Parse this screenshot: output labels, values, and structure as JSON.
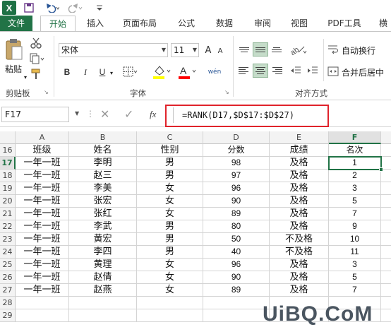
{
  "app": {
    "logo_letter": "X"
  },
  "quick_access": {
    "save_icon": "save-icon",
    "undo_icon": "undo-icon",
    "redo_icon": "redo-icon",
    "customize": "customize-arrow"
  },
  "tabs": [
    {
      "label": "文件"
    },
    {
      "label": "开始"
    },
    {
      "label": "插入"
    },
    {
      "label": "页面布局"
    },
    {
      "label": "公式"
    },
    {
      "label": "数据"
    },
    {
      "label": "审阅"
    },
    {
      "label": "视图"
    },
    {
      "label": "PDF工具"
    },
    {
      "label": "横"
    }
  ],
  "ribbon": {
    "clipboard": {
      "paste_label": "粘贴",
      "group_label": "剪贴板"
    },
    "font": {
      "font_name": "宋体",
      "font_size": "11",
      "bold": "B",
      "italic": "I",
      "underline": "U",
      "font_size_up": "A",
      "font_size_down": "A",
      "phonetic": "wén",
      "group_label": "字体"
    },
    "alignment": {
      "wrap_text": "自动换行",
      "merge_center": "合并后居中",
      "group_label": "对齐方式"
    }
  },
  "formula_bar": {
    "name_box": "F17",
    "fx": "fx",
    "formula": "=RANK(D17,$D$17:$D$27)"
  },
  "columns": [
    "A",
    "B",
    "C",
    "D",
    "E",
    "F"
  ],
  "rows": [
    {
      "n": "16",
      "a": "班级",
      "b": "姓名",
      "c": "性别",
      "d": "分数",
      "e": "成绩",
      "f": "名次"
    },
    {
      "n": "17",
      "a": "一年一班",
      "b": "李明",
      "c": "男",
      "d": "98",
      "e": "及格",
      "f": "1"
    },
    {
      "n": "18",
      "a": "一年一班",
      "b": "赵三",
      "c": "男",
      "d": "97",
      "e": "及格",
      "f": "2"
    },
    {
      "n": "19",
      "a": "一年一班",
      "b": "李美",
      "c": "女",
      "d": "96",
      "e": "及格",
      "f": "3"
    },
    {
      "n": "20",
      "a": "一年一班",
      "b": "张宏",
      "c": "女",
      "d": "90",
      "e": "及格",
      "f": "5"
    },
    {
      "n": "21",
      "a": "一年一班",
      "b": "张红",
      "c": "女",
      "d": "89",
      "e": "及格",
      "f": "7"
    },
    {
      "n": "22",
      "a": "一年一班",
      "b": "李武",
      "c": "男",
      "d": "80",
      "e": "及格",
      "f": "9"
    },
    {
      "n": "23",
      "a": "一年一班",
      "b": "黄宏",
      "c": "男",
      "d": "50",
      "e": "不及格",
      "f": "10"
    },
    {
      "n": "24",
      "a": "一年一班",
      "b": "李四",
      "c": "男",
      "d": "40",
      "e": "不及格",
      "f": "11"
    },
    {
      "n": "25",
      "a": "一年一班",
      "b": "黄理",
      "c": "女",
      "d": "96",
      "e": "及格",
      "f": "3"
    },
    {
      "n": "26",
      "a": "一年一班",
      "b": "赵倩",
      "c": "女",
      "d": "90",
      "e": "及格",
      "f": "5"
    },
    {
      "n": "27",
      "a": "一年一班",
      "b": "赵燕",
      "c": "女",
      "d": "89",
      "e": "及格",
      "f": "7"
    },
    {
      "n": "28",
      "a": "",
      "b": "",
      "c": "",
      "d": "",
      "e": "",
      "f": ""
    },
    {
      "n": "29",
      "a": "",
      "b": "",
      "c": "",
      "d": "",
      "e": "",
      "f": ""
    }
  ],
  "watermark": "UiBQ.CoM",
  "colors": {
    "excel_green": "#217346",
    "highlight_red": "#e0232b",
    "fill_yellow": "#ffff00",
    "font_red": "#ff0000"
  }
}
